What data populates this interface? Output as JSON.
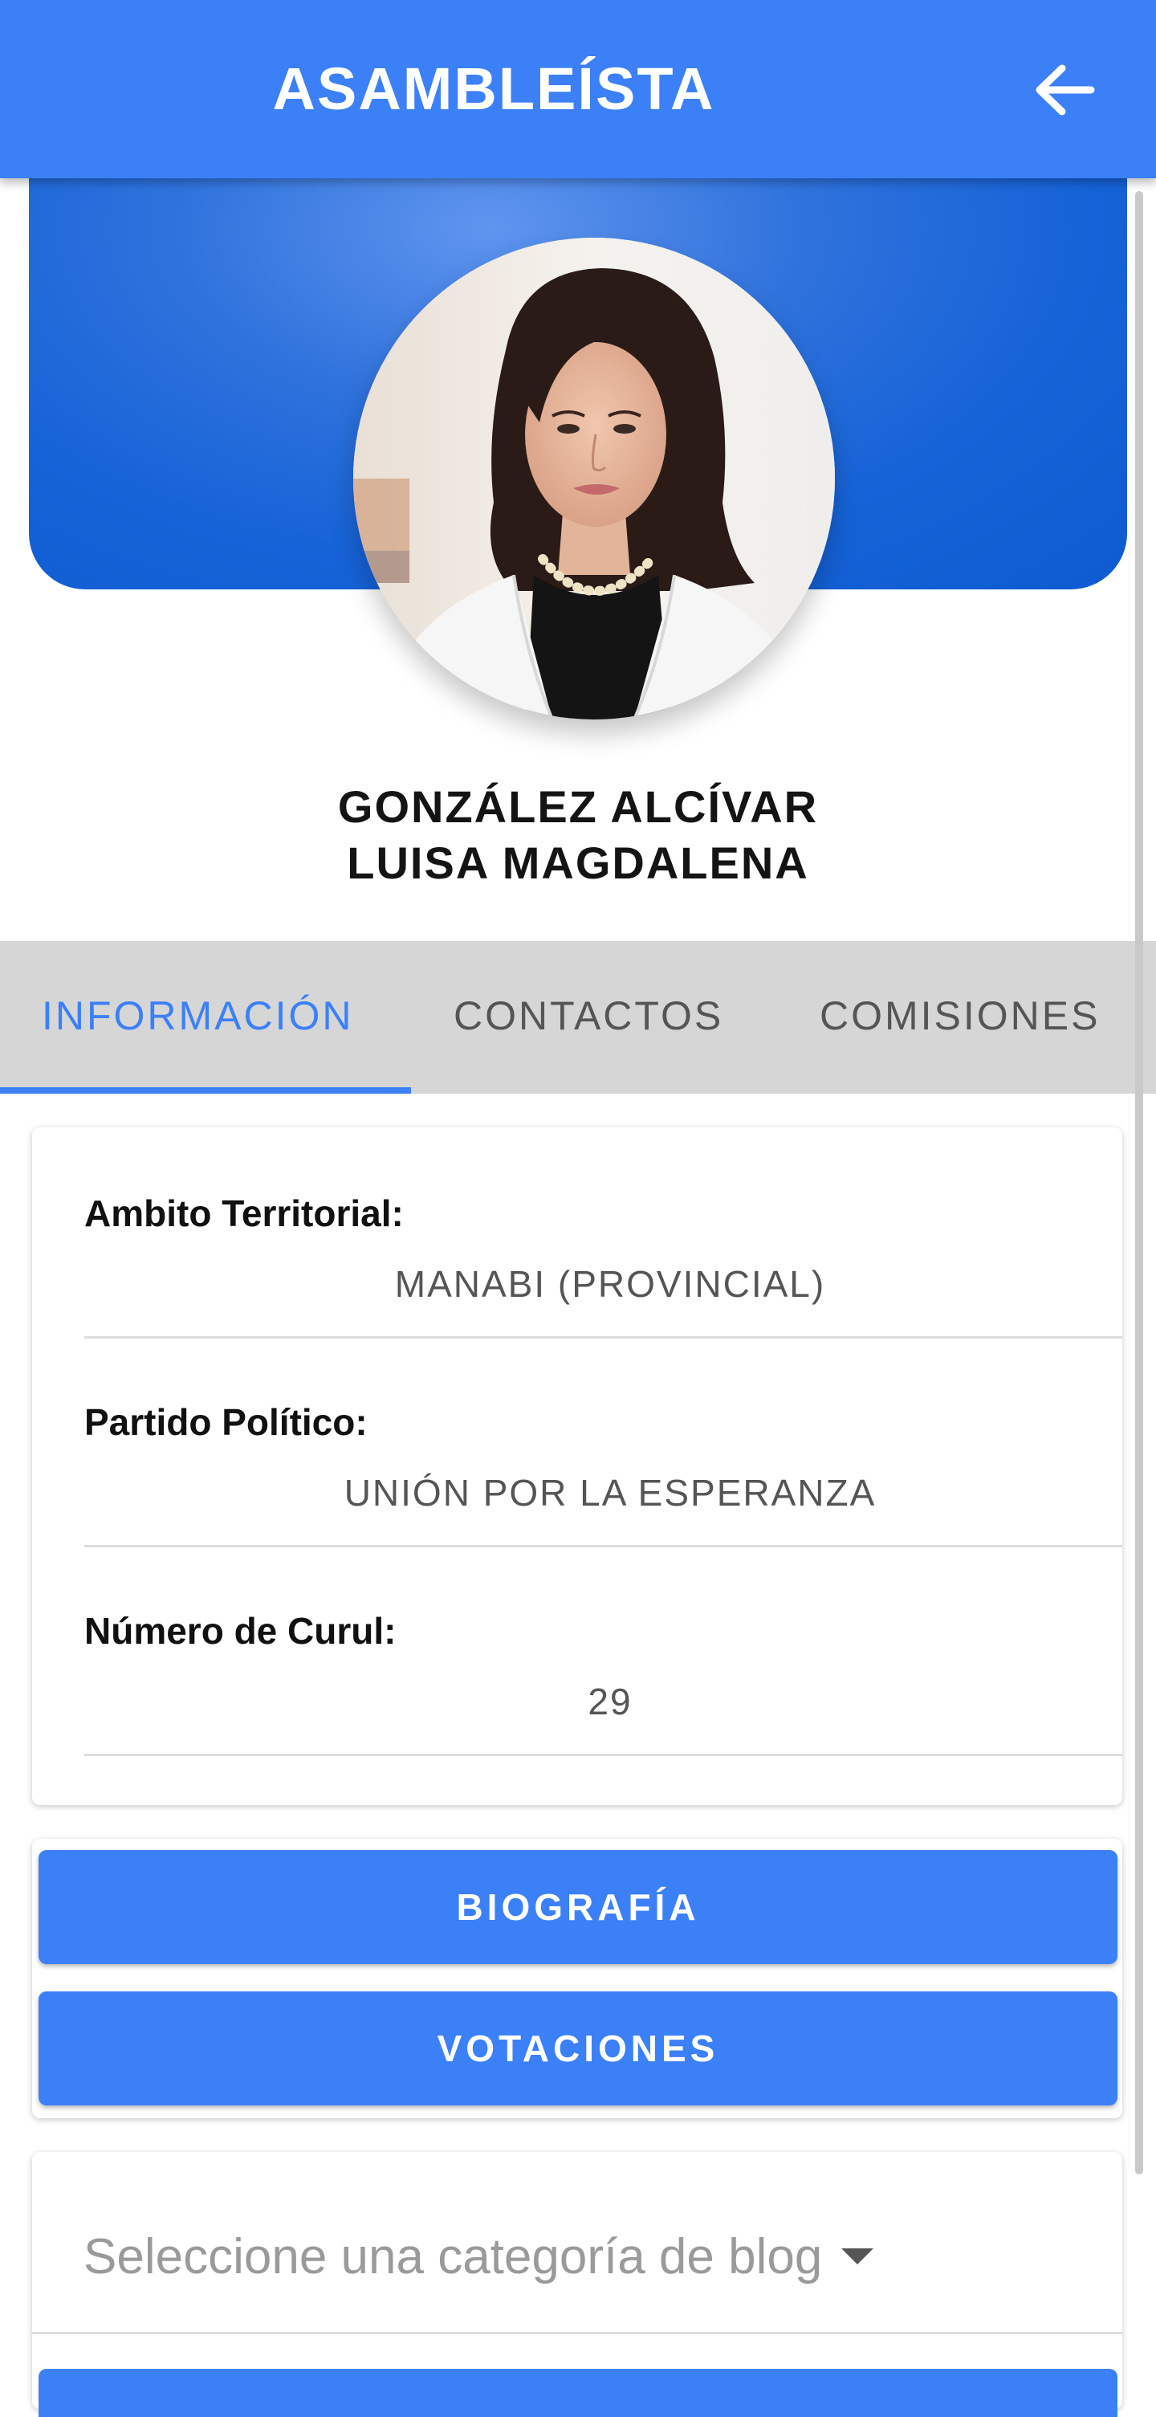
{
  "header": {
    "title": "ASAMBLEÍSTA",
    "back_icon": "arrow-left-icon"
  },
  "profile": {
    "name_line1": "GONZÁLEZ ALCÍVAR",
    "name_line2": "LUISA MAGDALENA"
  },
  "tabs": [
    {
      "label": "INFORMACIÓN",
      "active": true
    },
    {
      "label": "CONTACTOS",
      "active": false
    },
    {
      "label": "COMISIONES",
      "active": false
    }
  ],
  "info": [
    {
      "label": "Ambito Territorial:",
      "value": "MANABI (PROVINCIAL)"
    },
    {
      "label": "Partido Político:",
      "value": "UNIÓN POR LA ESPERANZA"
    },
    {
      "label": "Número de Curul:",
      "value": "29"
    }
  ],
  "buttons": {
    "biography": "BIOGRAFÍA",
    "votes": "VOTACIONES"
  },
  "blog_select": {
    "placeholder": "Seleccione una categoría de blog"
  },
  "colors": {
    "primary": "#3b80f7",
    "hero": "#1663d8",
    "tabs_bg": "#d6d6d6"
  }
}
